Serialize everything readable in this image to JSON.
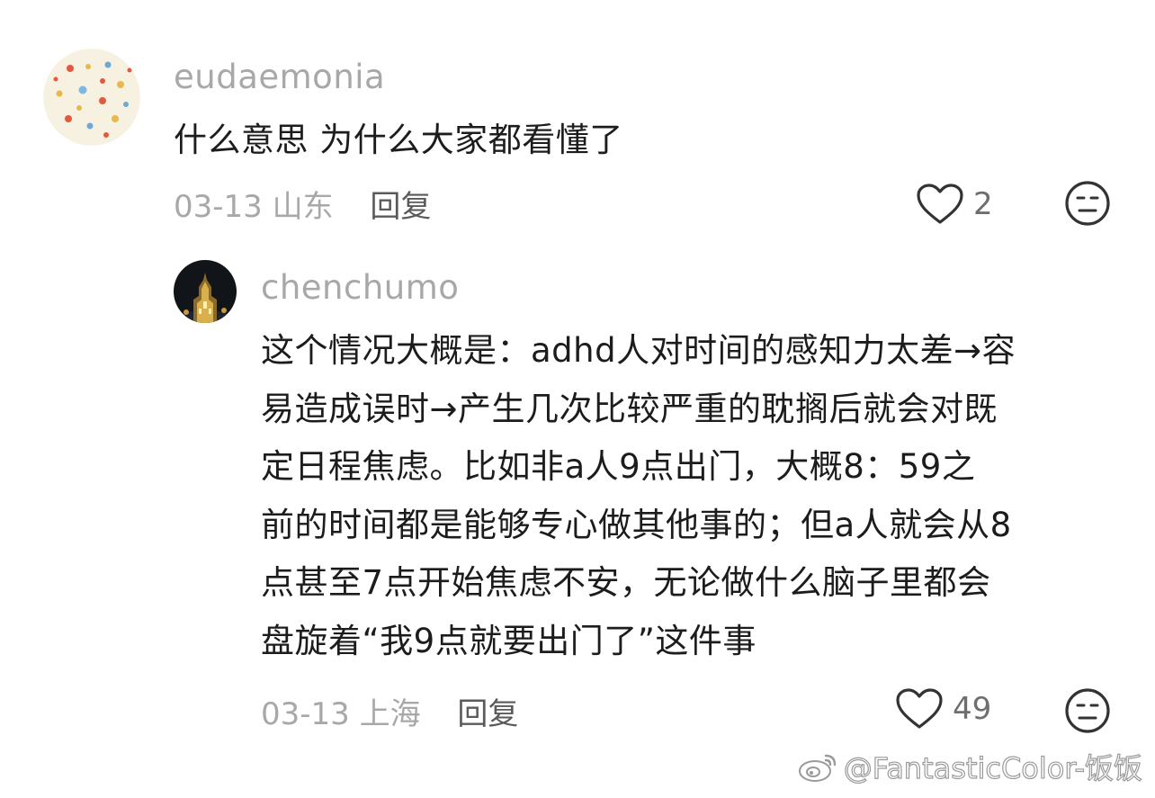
{
  "comments": [
    {
      "username": "eudaemonia",
      "text": "什么意思 为什么大家都看懂了",
      "date": "03-13",
      "location": "山东",
      "reply_label": "回复",
      "likes": "2",
      "avatar_icon": "cartoon-pattern-avatar"
    },
    {
      "username": "chenchumo",
      "text_lines": [
        "这个情况大概是：adhd人对时间的感知力太差→容",
        "易造成误时→产生几次比较严重的耽搁后就会对既",
        "定日程焦虑。比如非a人9点出门，大概8：59之",
        "前的时间都是能够专心做其他事的；但a人就会从8",
        "点甚至7点开始焦虑不安，无论做什么脑子里都会",
        "盘旋着“我9点就要出门了”这件事"
      ],
      "date": "03-13",
      "location": "上海",
      "reply_label": "回复",
      "likes": "49",
      "avatar_icon": "night-cathedral-avatar"
    }
  ],
  "icons": {
    "like": "heart-outline-icon",
    "emoji": "neutral-face-icon",
    "watermark": "weibo-logo-icon"
  },
  "watermark": "@FantasticColor-饭饭",
  "colors": {
    "username": "#a8a8a8",
    "text": "#1c1c1c",
    "meta": "#a8a8a8",
    "reply": "#5a5a5a",
    "icon": "#333333"
  }
}
